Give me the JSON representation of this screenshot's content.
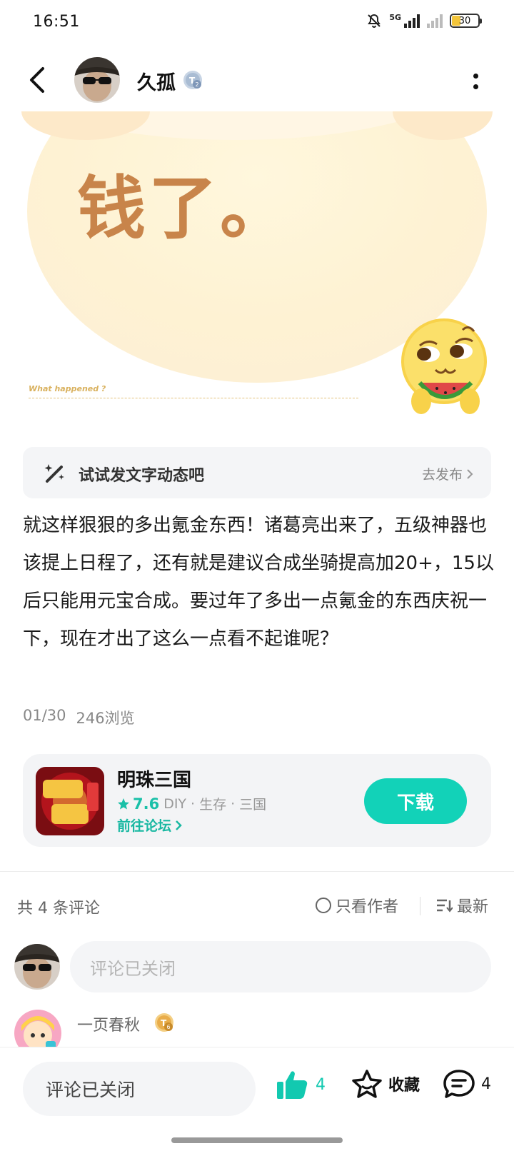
{
  "status_bar": {
    "time": "16:51",
    "network": "5G",
    "battery": "30",
    "icons": [
      "mute-icon",
      "signal-icon",
      "battery-icon"
    ]
  },
  "header": {
    "author_name": "久孤",
    "badge": "T2"
  },
  "hero": {
    "headline": "钱了。",
    "caption": "What happened ?"
  },
  "prompt_bar": {
    "text": "试试发文字动态吧",
    "action": "去发布"
  },
  "post": {
    "body": "就这样狠狠的多出氪金东西！诸葛亮出来了，五级神器也该提上日程了，还有就是建议合成坐骑提高加20+，15以后只能用元宝合成。要过年了多出一点氪金的东西庆祝一下，现在才出了这么一点看不起谁呢？",
    "date": "01/30",
    "views": "246浏览"
  },
  "game_card": {
    "name": "明珠三国",
    "rating": "7.6",
    "tags": [
      "DIY",
      "生存",
      "三国"
    ],
    "forum_link": "前往论坛",
    "download_label": "下载",
    "accent_color": "#12d2b8"
  },
  "comments": {
    "count_label": "共 4 条评论",
    "filter_author": "只看作者",
    "sort": "最新",
    "input_placeholder": "评论已关闭",
    "first_commenter": {
      "name": "一页春秋",
      "badge": "T6"
    }
  },
  "bottom_bar": {
    "input_label": "评论已关闭",
    "like_count": "4",
    "fav_label": "收藏",
    "comment_count": "4"
  }
}
